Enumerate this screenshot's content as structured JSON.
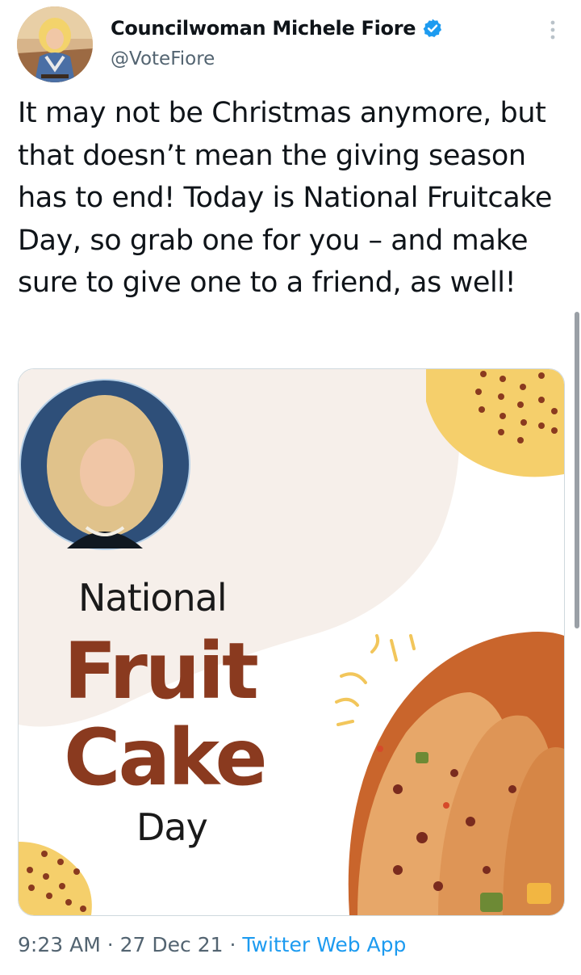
{
  "tweet": {
    "author": {
      "display_name": "Councilwoman Michele Fiore",
      "handle": "@VoteFiore",
      "verified": true
    },
    "text": "It may not be Christmas anymore, but that doesn’t mean the giving season has to end! Today is National Fruitcake Day, so grab one for you – and make sure to give one to a friend, as well!",
    "image": {
      "line1": "National",
      "line2": "Fruit",
      "line3": "Cake",
      "line4": "Day"
    },
    "meta": {
      "time": "9:23 AM",
      "sep1": " · ",
      "date": "27 Dec 21",
      "sep2": " · ",
      "source": "Twitter Web App"
    }
  },
  "icons": {
    "verified": "verified-badge-icon",
    "more": "more-vertical-icon"
  },
  "colors": {
    "brand_blue": "#1d9bf0",
    "title_brown": "#8a3a1f",
    "accent_yellow": "#f5cf6b",
    "muted_text": "#536471"
  }
}
